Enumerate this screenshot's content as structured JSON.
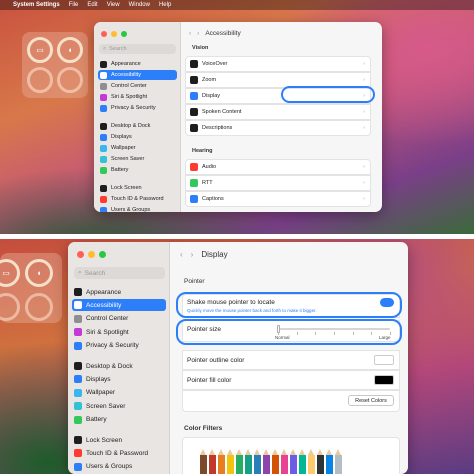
{
  "menubar": {
    "apple": "",
    "app": "System Settings",
    "items": [
      "File",
      "Edit",
      "View",
      "Window",
      "Help"
    ]
  },
  "panel1": {
    "search_placeholder": "Search",
    "sidebar": [
      {
        "label": "Appearance",
        "color": "#1e1e1e"
      },
      {
        "label": "Accessibility",
        "color": "#2d7ff9",
        "selected": true
      },
      {
        "label": "Control Center",
        "color": "#8e8e93"
      },
      {
        "label": "Siri & Spotlight",
        "color": "#c43ad6"
      },
      {
        "label": "Privacy & Security",
        "color": "#2d7ff9"
      },
      {
        "label": "Desktop & Dock",
        "color": "#1e1e1e"
      },
      {
        "label": "Displays",
        "color": "#2d7ff9"
      },
      {
        "label": "Wallpaper",
        "color": "#38b6f0"
      },
      {
        "label": "Screen Saver",
        "color": "#33c1d6"
      },
      {
        "label": "Battery",
        "color": "#34c759"
      },
      {
        "label": "Lock Screen",
        "color": "#1e1e1e"
      },
      {
        "label": "Touch ID & Password",
        "color": "#ff3b30"
      },
      {
        "label": "Users & Groups",
        "color": "#2d7ff9"
      }
    ],
    "title": "Accessibility",
    "vision_header": "Vision",
    "vision": [
      {
        "label": "VoiceOver",
        "color": "#1e1e1e"
      },
      {
        "label": "Zoom",
        "color": "#1e1e1e"
      },
      {
        "label": "Display",
        "color": "#2d7ff9"
      },
      {
        "label": "Spoken Content",
        "color": "#1e1e1e"
      },
      {
        "label": "Descriptions",
        "color": "#1e1e1e"
      }
    ],
    "hearing_header": "Hearing",
    "hearing": [
      {
        "label": "Audio",
        "color": "#ff3b30"
      },
      {
        "label": "RTT",
        "color": "#34c759"
      },
      {
        "label": "Captions",
        "color": "#2d7ff9"
      }
    ]
  },
  "panel2": {
    "search_placeholder": "Search",
    "sidebar": [
      {
        "label": "Appearance",
        "color": "#1e1e1e"
      },
      {
        "label": "Accessibility",
        "color": "#2d7ff9",
        "selected": true
      },
      {
        "label": "Control Center",
        "color": "#8e8e93"
      },
      {
        "label": "Siri & Spotlight",
        "color": "#c43ad6"
      },
      {
        "label": "Privacy & Security",
        "color": "#2d7ff9"
      },
      {
        "label": "Desktop & Dock",
        "color": "#1e1e1e"
      },
      {
        "label": "Displays",
        "color": "#2d7ff9"
      },
      {
        "label": "Wallpaper",
        "color": "#38b6f0"
      },
      {
        "label": "Screen Saver",
        "color": "#33c1d6"
      },
      {
        "label": "Battery",
        "color": "#34c759"
      },
      {
        "label": "Lock Screen",
        "color": "#1e1e1e"
      },
      {
        "label": "Touch ID & Password",
        "color": "#ff3b30"
      },
      {
        "label": "Users & Groups",
        "color": "#2d7ff9"
      }
    ],
    "title": "Display",
    "pointer_header": "Pointer",
    "shake_label": "Shake mouse pointer to locate",
    "shake_desc": "Quickly move the mouse pointer back and forth to make it bigger.",
    "shake_on": true,
    "pointer_size_label": "Pointer size",
    "pointer_size_min": "Normal",
    "pointer_size_max": "Large",
    "pointer_size_value": 0,
    "outline_label": "Pointer outline color",
    "outline_color": "#ffffff",
    "fill_label": "Pointer fill color",
    "fill_color": "#000000",
    "reset_label": "Reset Colors",
    "color_filters_header": "Color Filters",
    "pencil_colors": [
      "#7a4a2a",
      "#c0392b",
      "#e67e22",
      "#f1c40f",
      "#27ae60",
      "#16a085",
      "#2980b9",
      "#8e44ad",
      "#d35400",
      "#e84393",
      "#6c5ce7",
      "#00b894",
      "#fdcb6e",
      "#2d3436",
      "#0984e3",
      "#b2bec3"
    ]
  }
}
